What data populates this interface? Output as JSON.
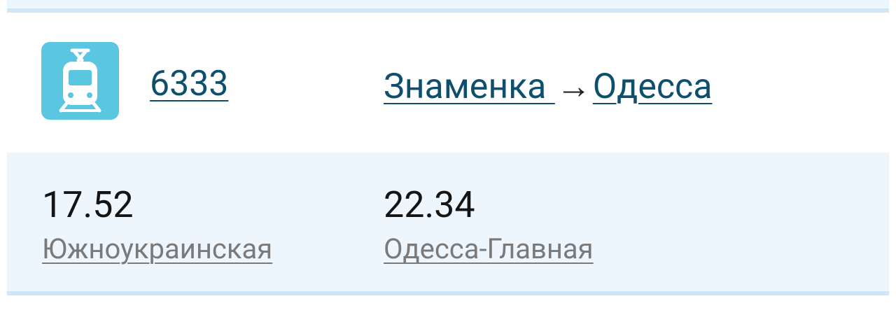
{
  "train": {
    "icon": "tram-icon",
    "number": "6333"
  },
  "route": {
    "from": "Знаменка ",
    "arrow": "→",
    "to": "Одесса"
  },
  "departure": {
    "time": "17.52",
    "station": "Южноукраинская"
  },
  "arrival": {
    "time": "22.34",
    "station": "Одесса-Главная"
  },
  "colors": {
    "icon_bg": "#5ac6df",
    "link": "#0f4f6e",
    "row_bg": "#eef6fd",
    "divider": "#cfe6f6",
    "station_text": "#7a7a7a"
  }
}
